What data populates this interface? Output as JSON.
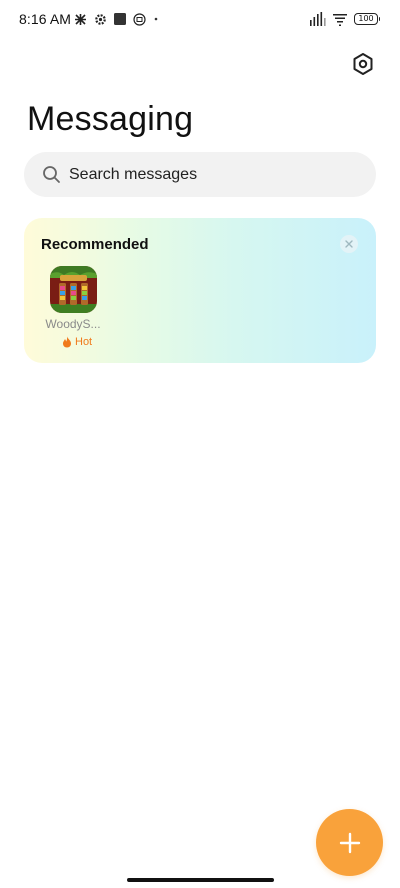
{
  "status_bar": {
    "time": "8:16 AM",
    "battery": "100",
    "icons_left": [
      "alarm-snooze-icon",
      "gear-icon",
      "square-app-icon",
      "badge-icon",
      "dot-icon"
    ],
    "icons_right": [
      "signal-icon",
      "wifi-icon",
      "battery-icon"
    ]
  },
  "header": {
    "title": "Messaging",
    "settings_icon": "hexagon-settings-icon"
  },
  "search": {
    "placeholder": "Search messages"
  },
  "recommended": {
    "title": "Recommended",
    "items": [
      {
        "name": "WoodyS...",
        "badge": "Hot",
        "badge_color": "#f07a1c"
      }
    ]
  },
  "colors": {
    "accent": "#f9a23b",
    "search_bg": "#f2f2f2",
    "hot": "#f07a1c"
  },
  "fab": {
    "icon": "plus-icon"
  }
}
